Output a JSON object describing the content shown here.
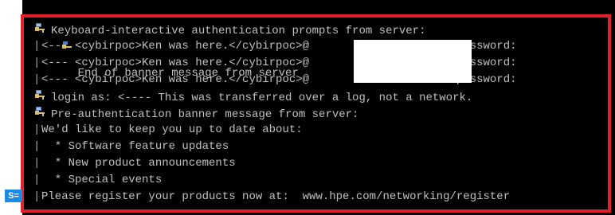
{
  "terminal": {
    "partial_top_line": "End of banner message from server",
    "lines": [
      {
        "icon": "key-icon",
        "text": "Keyboard-interactive authentication prompts from server:"
      },
      {
        "gutter": "|",
        "text": "<--- <cybirpoc>Ken was here.</cybirpoc>@                   's password:"
      },
      {
        "gutter": "|",
        "text": "<--- <cybirpoc>Ken was here.</cybirpoc>@                   's password:"
      },
      {
        "gutter": "|",
        "text": "<--- <cybirpoc>Ken was here.</cybirpoc>@                   's password:"
      },
      {
        "icon": "key-icon",
        "text": "login as: <---- This was transferred over a log, not a network."
      },
      {
        "icon": "key-icon",
        "text": "Pre-authentication banner message from server:"
      },
      {
        "gutter": "|",
        "text": "We'd like to keep you up to date about:"
      },
      {
        "gutter": "|",
        "text": "  * Software feature updates"
      },
      {
        "gutter": "|",
        "text": "  * New product announcements"
      },
      {
        "gutter": "|",
        "text": "  * Special events"
      },
      {
        "gutter": "|",
        "text": "Please register your products now at:  www.hpe.com/networking/register"
      }
    ]
  },
  "side_tag": {
    "label": "S="
  },
  "colors": {
    "highlight": "#e0202a",
    "terminal_bg": "#000000",
    "terminal_fg": "#c0c0c0",
    "tag_bg": "#1e88e5"
  }
}
